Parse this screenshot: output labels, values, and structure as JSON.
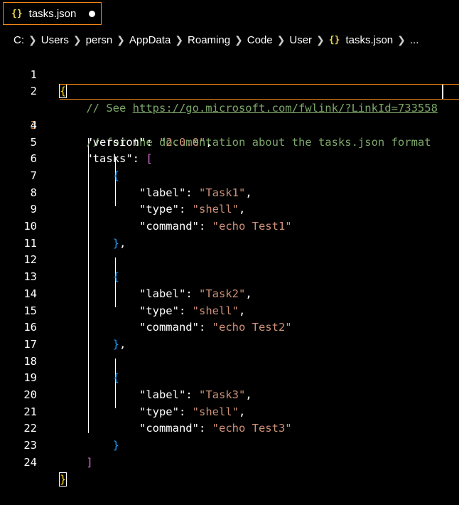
{
  "tab": {
    "icon": "{}",
    "label": "tasks.json",
    "dirty": true
  },
  "breadcrumb": {
    "items": [
      "C:",
      "Users",
      "persn",
      "AppData",
      "Roaming",
      "Code",
      "User"
    ],
    "file_icon": "{}",
    "file": "tasks.json",
    "more": "..."
  },
  "editor": {
    "active_line": 3,
    "line_numbers": [
      "1",
      "2",
      "3",
      "4",
      "5",
      "6",
      "7",
      "8",
      "9",
      "10",
      "11",
      "12",
      "13",
      "14",
      "15",
      "16",
      "17",
      "18",
      "19",
      "20",
      "21",
      "22",
      "23",
      "24"
    ],
    "code": {
      "open_brace": "{",
      "comment1_prefix": "// See ",
      "comment1_link": "https://go.microsoft.com/fwlink/?LinkId=733558",
      "comment2": "// for the documentation about the tasks.json format",
      "version_key": "\"version\"",
      "version_val": "\"2.0.0\"",
      "tasks_key": "\"tasks\"",
      "tasks": [
        {
          "label": "\"Task1\"",
          "type": "\"shell\"",
          "command": "\"echo Test1\""
        },
        {
          "label": "\"Task2\"",
          "type": "\"shell\"",
          "command": "\"echo Test2\""
        },
        {
          "label": "\"Task3\"",
          "type": "\"shell\"",
          "command": "\"echo Test3\""
        }
      ],
      "label_key": "\"label\"",
      "type_key": "\"type\"",
      "command_key": "\"command\"",
      "colon": ": ",
      "comma": ",",
      "open_bracket": "[",
      "close_bracket": "]",
      "close_brace": "}",
      "close_brace_comma": "},"
    }
  },
  "colors": {
    "accent": "#f38518",
    "background": "#000000",
    "string": "#ce9178",
    "comment": "#7ca668",
    "brace_level1": "#ffd700",
    "brace_level2": "#da70d6",
    "brace_level3": "#179fff"
  }
}
